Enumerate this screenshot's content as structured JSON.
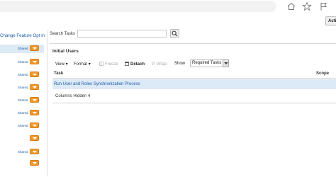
{
  "browser": {
    "icons": [
      "home-icon",
      "star-icon",
      "flag-icon"
    ]
  },
  "actions_button": "Acti",
  "left_panel": {
    "link": "Change Feature Opt In",
    "rows": [
      {
        "label": "Shared",
        "selected": true
      },
      {
        "label": "Shared",
        "selected": false
      },
      {
        "label": "Shared",
        "selected": false
      },
      {
        "label": "Shared",
        "selected": false
      },
      {
        "label": "Shared",
        "selected": false
      },
      {
        "label": "Shared",
        "selected": false
      },
      {
        "label": "Shared",
        "selected": false
      },
      {
        "label": "",
        "selected": false
      },
      {
        "label": "Shared",
        "selected": false
      },
      {
        "label": "",
        "selected": false
      }
    ]
  },
  "search": {
    "label": "Search Tasks",
    "value": ""
  },
  "region": {
    "title": "Initial Users",
    "toolbar": {
      "view": "View",
      "format": "Format",
      "freeze": "Freeze",
      "detach": "Detach",
      "wrap": "Wrap",
      "show_label": "Show",
      "show_value": "Required Tasks"
    },
    "columns": {
      "task": "Task",
      "scope": "Scope"
    },
    "rows": [
      {
        "task": "Run User and Roles Synchronization Process"
      }
    ],
    "columns_hidden": "Columns Hidden  4"
  }
}
